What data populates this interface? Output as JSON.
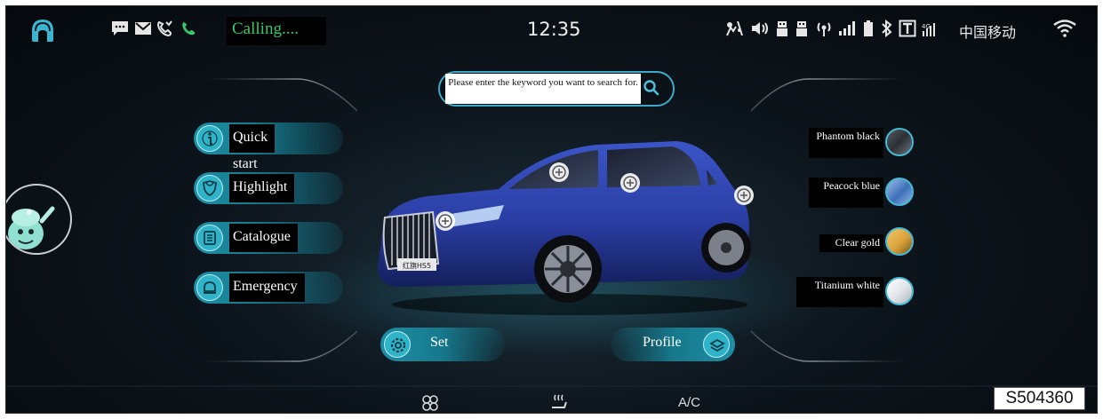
{
  "status_bar": {
    "calling_text": "Calling....",
    "time": "12:35",
    "carrier": "中国移动"
  },
  "search": {
    "placeholder": "Please enter the keyword you want to search for."
  },
  "menu": [
    {
      "label": "Quick start",
      "icon": "info-icon"
    },
    {
      "label": "Highlight",
      "icon": "shield-icon"
    },
    {
      "label": "Catalogue",
      "icon": "book-icon"
    },
    {
      "label": "Emergency",
      "icon": "bell-icon"
    }
  ],
  "colors": [
    {
      "label": "Phantom black",
      "swatch": "#2c3035"
    },
    {
      "label": "Peacock blue",
      "swatch": "#3d6fb8"
    },
    {
      "label": "Clear gold",
      "swatch": "#d9a23b"
    },
    {
      "label": "Titanium white",
      "swatch": "#dfe3e8"
    }
  ],
  "bottom_buttons": {
    "set": "Set",
    "profile": "Profile"
  },
  "bottom_bar": {
    "ac_label": "A/C"
  },
  "figure_code": "S504360",
  "car": {
    "badge_text": "红旗HS5",
    "body_color": "#2b3fa8"
  },
  "theme": {
    "accent": "#2fb3c9",
    "calling_green": "#36c86a"
  }
}
